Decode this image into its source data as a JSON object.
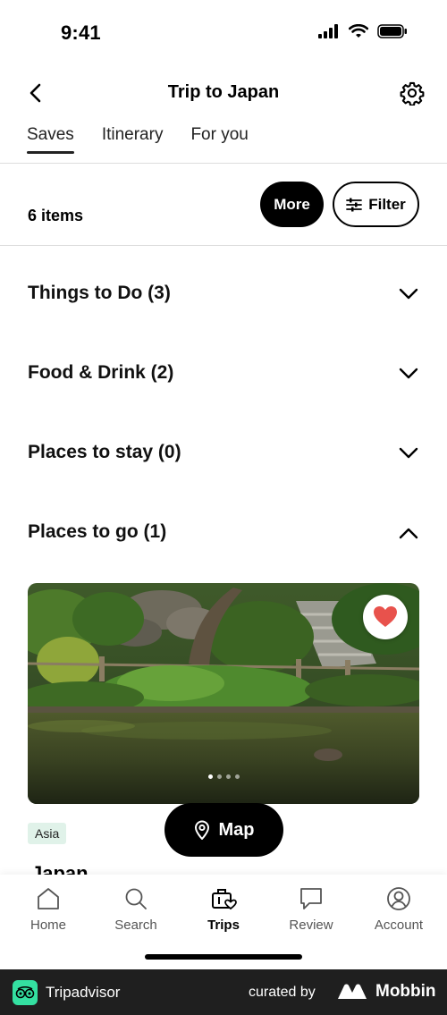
{
  "status_bar": {
    "time": "9:41"
  },
  "header": {
    "title": "Trip to Japan"
  },
  "tabs": [
    {
      "label": "Saves",
      "active": true
    },
    {
      "label": "Itinerary",
      "active": false
    },
    {
      "label": "For you",
      "active": false
    }
  ],
  "toolbar": {
    "count": "6 items",
    "more_label": "More",
    "filter_label": "Filter"
  },
  "sections": [
    {
      "title": "Things to Do (3)",
      "expanded": false
    },
    {
      "title": "Food & Drink (2)",
      "expanded": false
    },
    {
      "title": "Places to stay (0)",
      "expanded": false
    },
    {
      "title": "Places to go (1)",
      "expanded": true
    }
  ],
  "card": {
    "tag": "Asia",
    "name": "Japan",
    "image_index": 1,
    "image_count": 4,
    "saved": true
  },
  "map_button": {
    "label": "Map"
  },
  "bottom_nav": [
    {
      "label": "Home",
      "icon": "home-icon",
      "active": false
    },
    {
      "label": "Search",
      "icon": "search-icon",
      "active": false
    },
    {
      "label": "Trips",
      "icon": "trips-icon",
      "active": true
    },
    {
      "label": "Review",
      "icon": "review-icon",
      "active": false
    },
    {
      "label": "Account",
      "icon": "account-icon",
      "active": false
    }
  ],
  "footer": {
    "brand": "Tripadvisor",
    "curated_by": "curated by",
    "curator": "Mobbin"
  },
  "colors": {
    "accent": "#000000",
    "heart": "#e8524c",
    "tag_bg": "#e0f2e9",
    "footer_bg": "#1f1f1f",
    "tripadvisor_green": "#34e0a1"
  }
}
